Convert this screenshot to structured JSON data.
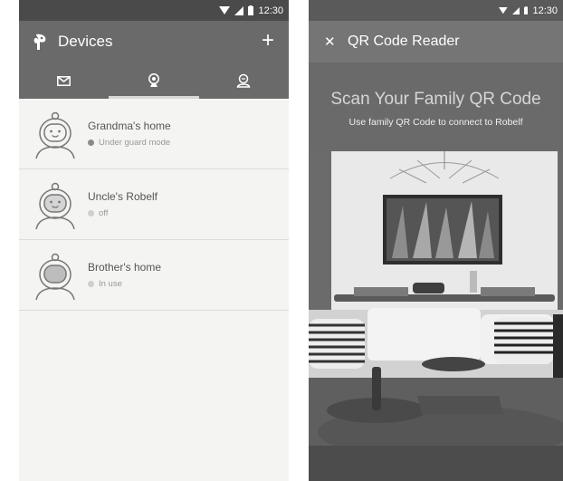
{
  "left": {
    "status_time": "12:30",
    "title": "Devices",
    "add_label": "+",
    "icons": {
      "logo": "robelf-logo-icon",
      "mail": "mail-icon",
      "camera": "webcam-icon",
      "user": "user-icon"
    },
    "devices": [
      {
        "name": "Grandma's home",
        "status": "Under guard mode",
        "dot_color": "#8a8a8a"
      },
      {
        "name": "Uncle's Robelf",
        "status": "off",
        "dot_color": "#cfcfcf"
      },
      {
        "name": "Brother's home",
        "status": "In use",
        "dot_color": "#cfcfcf"
      }
    ]
  },
  "right": {
    "status_time": "12:30",
    "title": "QR Code Reader",
    "close_label": "✕",
    "heading": "Scan Your Family QR Code",
    "subheading": "Use family QR Code to connect to Robelf"
  }
}
